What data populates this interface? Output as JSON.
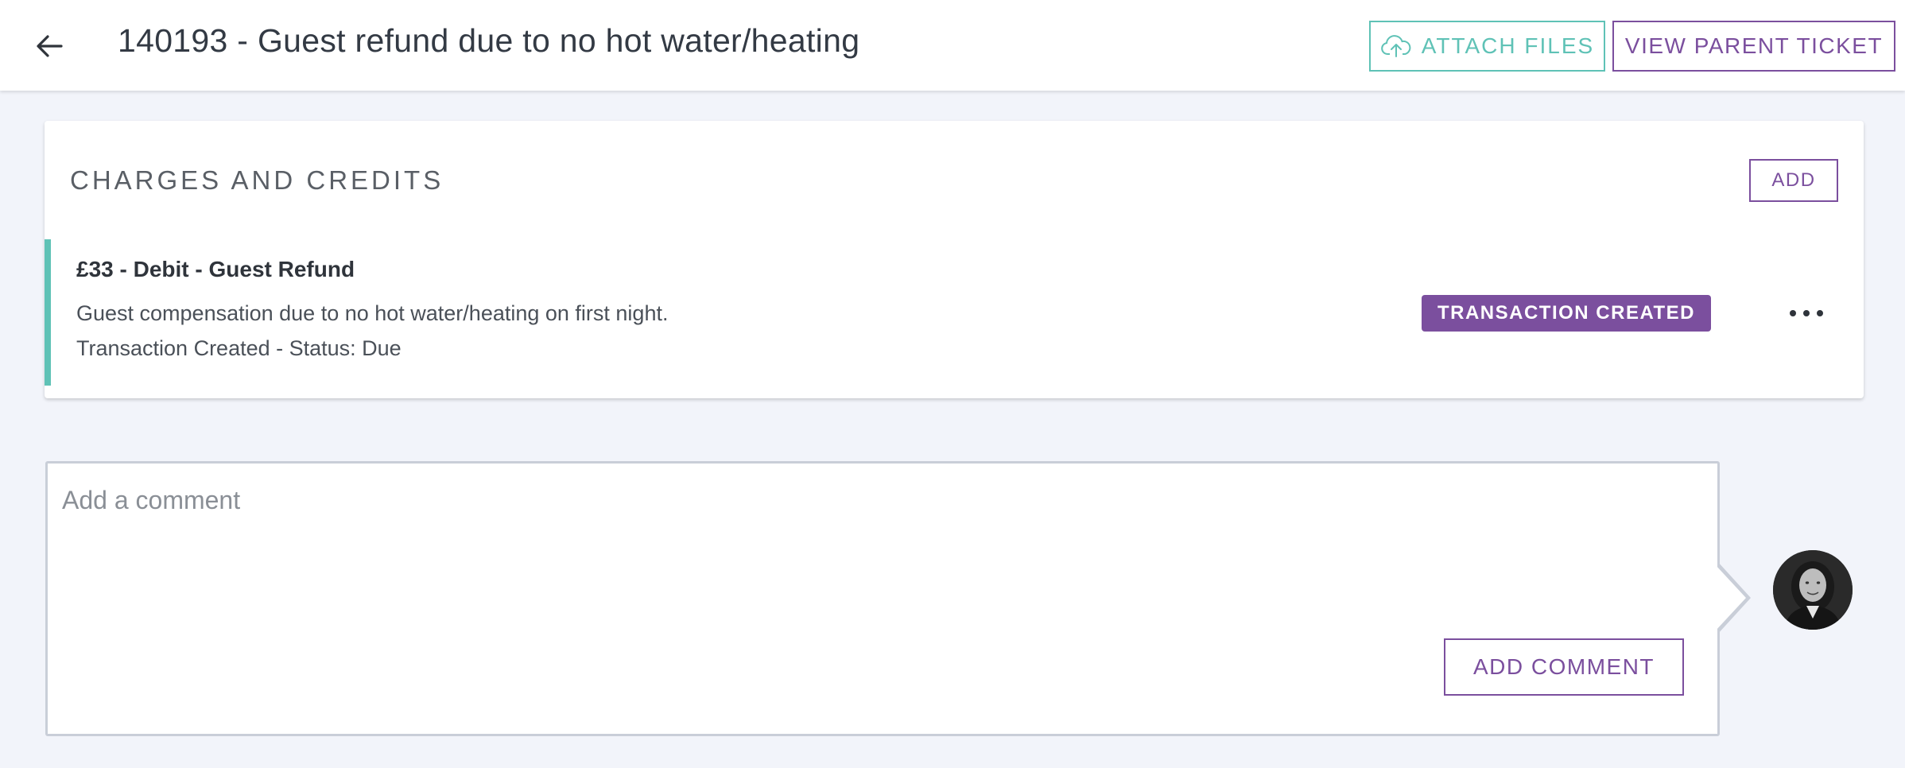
{
  "header": {
    "title": "140193 - Guest refund due to no hot water/heating",
    "attach_label": "ATTACH FILES",
    "view_parent_label": "VIEW PARENT TICKET",
    "back_icon": "arrow-left-icon"
  },
  "charges": {
    "title": "CHARGES AND CREDITS",
    "add_label": "ADD",
    "items": [
      {
        "title": "£33 - Debit - Guest Refund",
        "description": "Guest compensation due to no hot water/heating on first night.",
        "status": "Transaction Created - Status: Due",
        "badge": "TRANSACTION CREATED",
        "accent_color": "#5fc2b6",
        "badge_color": "#7b4f9e"
      }
    ]
  },
  "comment": {
    "placeholder": "Add a comment",
    "value": "",
    "submit_label": "ADD COMMENT"
  },
  "colors": {
    "primary": "#7b4f9e",
    "teal": "#5fc2b6",
    "background": "#f2f4fa"
  }
}
